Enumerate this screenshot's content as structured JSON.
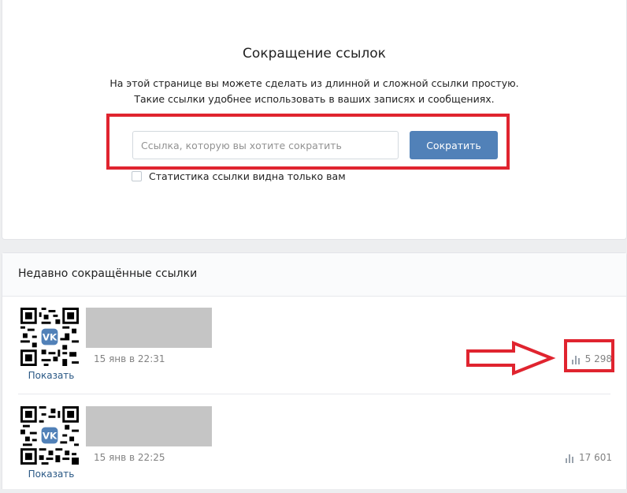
{
  "shortener": {
    "title": "Сокращение ссылок",
    "description_line1": "На этой странице вы можете сделать из длинной и сложной ссылки простую.",
    "description_line2": "Такие ссылки удобнее использовать в ваших записях и сообщениях.",
    "input_placeholder": "Ссылка, которую вы хотите сократить",
    "input_value": "",
    "button_label": "Сократить",
    "stats_checkbox_label": "Статистика ссылки видна только вам",
    "stats_checkbox_checked": false
  },
  "recent": {
    "title": "Недавно сокращённые ссылки",
    "links": [
      {
        "show_label": "Показать",
        "date": "15 янв в 22:31",
        "views": "5 298",
        "qr_icon": "vk-logo-icon"
      },
      {
        "show_label": "Показать",
        "date": "15 янв в 22:25",
        "views": "17 601",
        "qr_icon": "vk-logo-icon"
      }
    ]
  },
  "annotations": {
    "highlight_color": "#e0242f"
  },
  "colors": {
    "accent": "#5181b8",
    "link": "#2a5885",
    "muted": "#828282"
  }
}
